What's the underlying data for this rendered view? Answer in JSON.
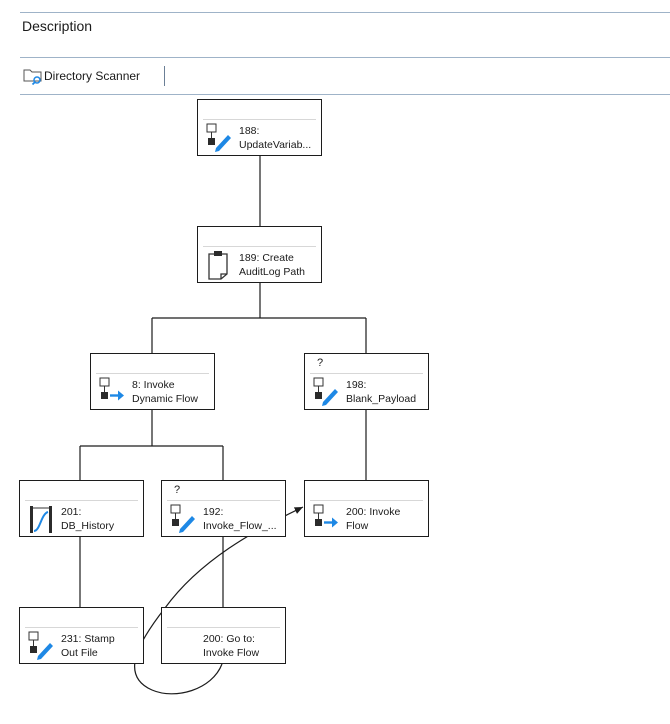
{
  "header": {
    "description_label": "Description"
  },
  "toolbar": {
    "tab_label": "Directory Scanner"
  },
  "nodes": [
    {
      "id": "n188",
      "label": "188:\nUpdateVariab...",
      "icon": "update-variable-icon",
      "flag": ""
    },
    {
      "id": "n189",
      "label": "189: Create\nAuditLog Path",
      "icon": "clipboard-icon",
      "flag": ""
    },
    {
      "id": "n8",
      "label": "8: Invoke\nDynamic Flow",
      "icon": "invoke-flow-icon",
      "flag": ""
    },
    {
      "id": "n198",
      "label": "198:\nBlank_Payload",
      "icon": "update-variable-icon",
      "flag": "?"
    },
    {
      "id": "n201",
      "label": "201:\nDB_History",
      "icon": "db-history-icon",
      "flag": ""
    },
    {
      "id": "n192",
      "label": "192:\nInvoke_Flow_...",
      "icon": "update-variable-icon",
      "flag": "?"
    },
    {
      "id": "n200",
      "label": "200: Invoke\nFlow",
      "icon": "invoke-flow-icon",
      "flag": ""
    },
    {
      "id": "n231",
      "label": "231: Stamp\nOut File",
      "icon": "update-variable-icon",
      "flag": ""
    },
    {
      "id": "n200goto",
      "label": "200: Go to:\nInvoke Flow",
      "icon": "",
      "flag": ""
    }
  ],
  "colors": {
    "accent": "#1e88e5",
    "border": "#1c1c1c",
    "rule": "#9fb3c8"
  }
}
